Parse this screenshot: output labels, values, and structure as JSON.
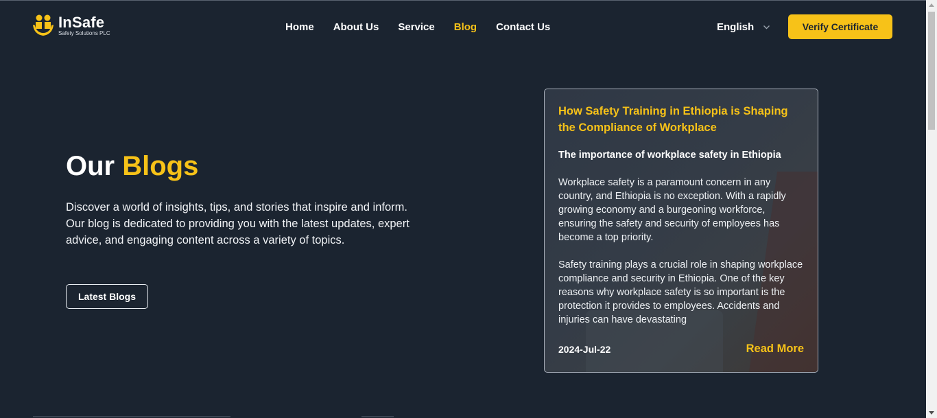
{
  "header": {
    "logo": {
      "name": "InSafe",
      "subtitle": "Safety Solutions PLC"
    },
    "nav": [
      {
        "label": "Home",
        "active": false
      },
      {
        "label": "About Us",
        "active": false
      },
      {
        "label": "Service",
        "active": false
      },
      {
        "label": "Blog",
        "active": true
      },
      {
        "label": "Contact Us",
        "active": false
      }
    ],
    "language": {
      "selected": "English",
      "icon": "chevron-down-icon"
    },
    "verify_button": "Verify Certificate"
  },
  "hero": {
    "title_part1": "Our",
    "title_part2": "Blogs",
    "description": "Discover a world of insights, tips, and stories that inspire and inform. Our blog is dedicated to providing you with the latest updates, expert advice, and engaging content across a variety of topics.",
    "button": "Latest Blogs"
  },
  "blog_card": {
    "title": "How Safety Training in Ethiopia is Shaping the Compliance of Workplace",
    "subtitle": "The importance of workplace safety in Ethiopia",
    "paragraph1": "Workplace safety is a paramount concern in any country, and Ethiopia is no exception. With a rapidly growing economy and a burgeoning workforce, ensuring the safety and security of employees has become a top priority.",
    "paragraph2": "Safety training plays a crucial role in shaping workplace compliance and security in Ethiopia. One of the key reasons why workplace safety is so important is the protection it provides to employees. Accidents and injuries can have devastating",
    "date": "2024-Jul-22",
    "read_more": "Read More"
  },
  "colors": {
    "background": "#1b2430",
    "accent": "#f7c218",
    "text": "#ffffff"
  }
}
